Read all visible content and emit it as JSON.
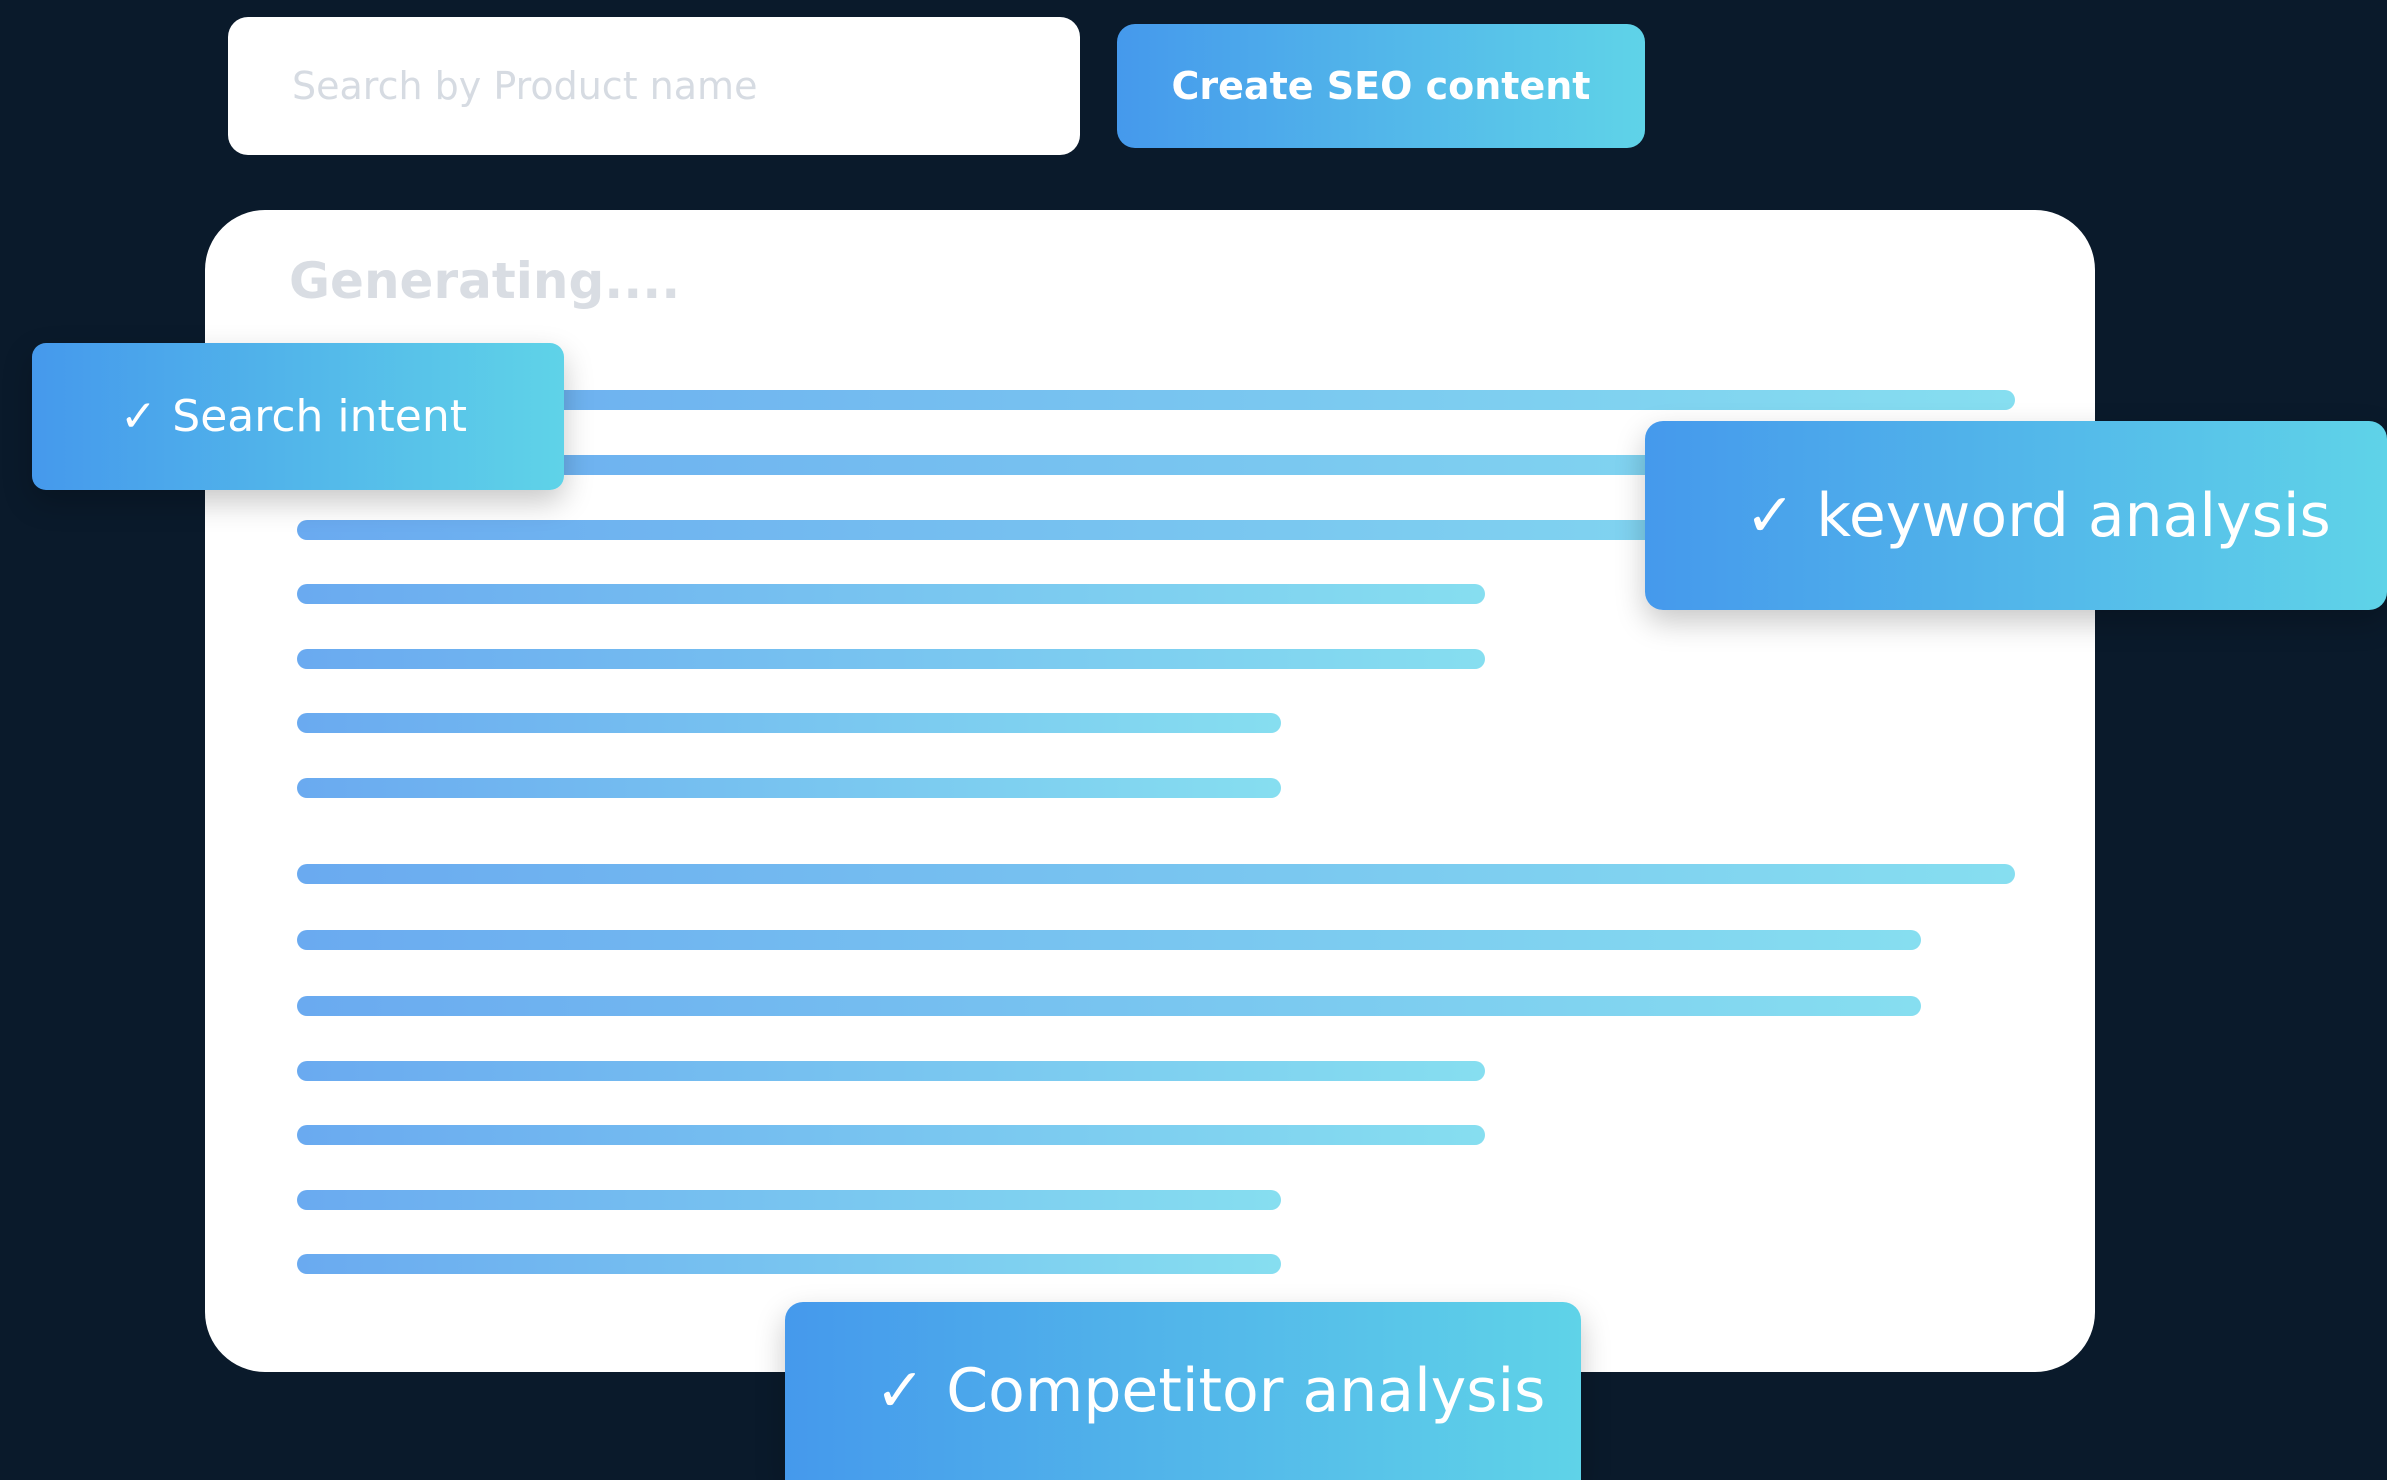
{
  "search": {
    "placeholder": "Search by Product name"
  },
  "toolbar": {
    "create_label": "Create SEO content"
  },
  "card": {
    "title": "Generating...."
  },
  "badges": {
    "search_intent": {
      "check": "✓",
      "label": "Search intent"
    },
    "keyword_analysis": {
      "check": "✓",
      "label": "keyword analysis"
    },
    "competitor_analysis": {
      "check": "✓",
      "label": "Competitor analysis"
    }
  },
  "colors": {
    "background": "#0a1a2b",
    "accent_start": "#4599ec",
    "accent_end": "#5fd3e8",
    "placeholder_text": "#d9dde3"
  }
}
